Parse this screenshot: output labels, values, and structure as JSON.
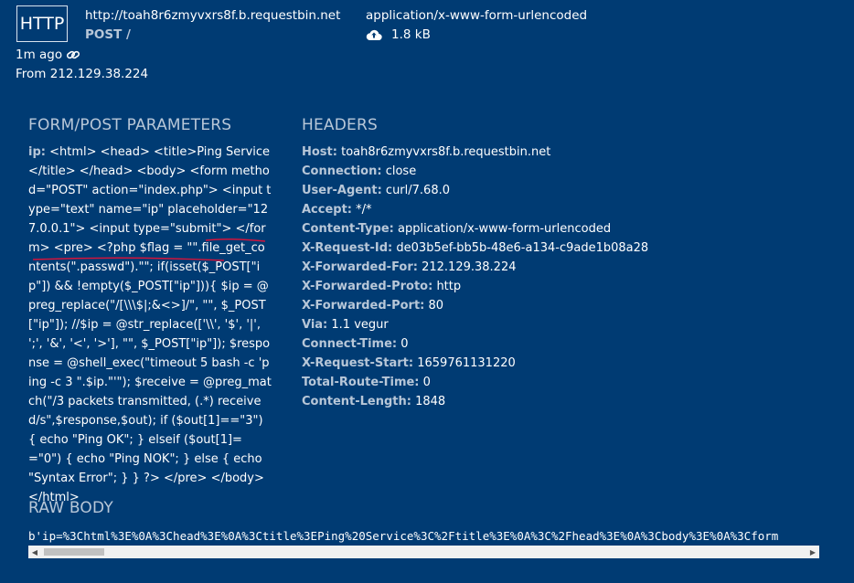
{
  "request": {
    "badge": "HTTP",
    "url": "http://toah8r6zmyvxrs8f.b.requestbin.net",
    "method": "POST",
    "path": "/",
    "content_type": "application/x-www-form-urlencoded",
    "size": "1.8 kB",
    "ago": "1m ago",
    "from": "From 212.129.38.224"
  },
  "form": {
    "heading": "FORM/POST PARAMETERS",
    "key": "ip:",
    "value": "<html> <head> <title>Ping Service</title> </head> <body> <form method=\"POST\" action=\"index.php\"> <input type=\"text\" name=\"ip\" placeholder=\"127.0.0.1\"> <input type=\"submit\"> </form> <pre> <?php $flag = \"\".file_get_contents(\".passwd\").\"\"; if(isset($_POST[\"ip\"]) && !empty($_POST[\"ip\"])){ $ip = @preg_replace(\"/[\\\\\\$|;&<>]/\", \"\", $_POST[\"ip\"]); //$ip = @str_replace(['\\\\', '$', '|', ';', '&', '<', '>'], \"\", $_POST[\"ip\"]); $response = @shell_exec(\"timeout 5 bash -c 'ping -c 3 \".$ip.\"'\"); $receive = @preg_match(\"/3 packets transmitted, (.*) received/s\",$response,$out); if ($out[1]==\"3\") { echo \"Ping OK\"; } elseif ($out[1]==\"0\") { echo \"Ping NOK\"; } else { echo \"Syntax Error\"; } } ?> </pre> </body> </html>"
  },
  "headers": {
    "heading": "HEADERS",
    "rows": [
      {
        "k": "Host:",
        "v": "toah8r6zmyvxrs8f.b.requestbin.net"
      },
      {
        "k": "Connection:",
        "v": "close"
      },
      {
        "k": "User-Agent:",
        "v": "curl/7.68.0"
      },
      {
        "k": "Accept:",
        "v": "*/*"
      },
      {
        "k": "Content-Type:",
        "v": "application/x-www-form-urlencoded"
      },
      {
        "k": "X-Request-Id:",
        "v": "de03b5ef-bb5b-48e6-a134-c9ade1b08a28"
      },
      {
        "k": "X-Forwarded-For:",
        "v": "212.129.38.224"
      },
      {
        "k": "X-Forwarded-Proto:",
        "v": "http"
      },
      {
        "k": "X-Forwarded-Port:",
        "v": "80"
      },
      {
        "k": "Via:",
        "v": "1.1 vegur"
      },
      {
        "k": "Connect-Time:",
        "v": "0"
      },
      {
        "k": "X-Request-Start:",
        "v": "1659761131220"
      },
      {
        "k": "Total-Route-Time:",
        "v": "0"
      },
      {
        "k": "Content-Length:",
        "v": "1848"
      }
    ]
  },
  "raw": {
    "heading": "RAW BODY",
    "text": "b'ip=%3Chtml%3E%0A%3Chead%3E%0A%3Ctitle%3EPing%20Service%3C%2Ftitle%3E%0A%3C%2Fhead%3E%0A%3Cbody%3E%0A%3Cform"
  },
  "icons": {
    "cloud": "cloud-upload-icon",
    "link": "link-icon"
  },
  "colors": {
    "background": "#003b73",
    "muted": "#b8c7d8",
    "annotation": "#d4143c"
  }
}
